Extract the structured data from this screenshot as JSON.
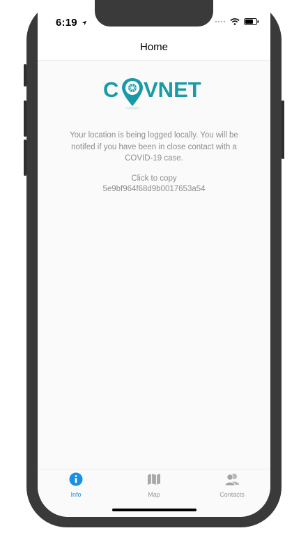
{
  "status_bar": {
    "time": "6:19"
  },
  "nav": {
    "title": "Home"
  },
  "brand": {
    "logo_text_left": "C",
    "logo_text_right": "VNET"
  },
  "info": {
    "message": "Your location is being logged locally. You will be notifed if you have been in close contact with a COVID-19 case.",
    "copy_label": "Click to copy",
    "copy_id": "5e9bf964f68d9b0017653a54"
  },
  "tabs": [
    {
      "label": "Info",
      "icon": "info-icon",
      "active": true
    },
    {
      "label": "Map",
      "icon": "map-icon",
      "active": false
    },
    {
      "label": "Contacts",
      "icon": "contacts-icon",
      "active": false
    }
  ],
  "colors": {
    "brand": "#1a9aa6",
    "active_tab": "#1a8fe6",
    "inactive_tab": "#999999"
  }
}
